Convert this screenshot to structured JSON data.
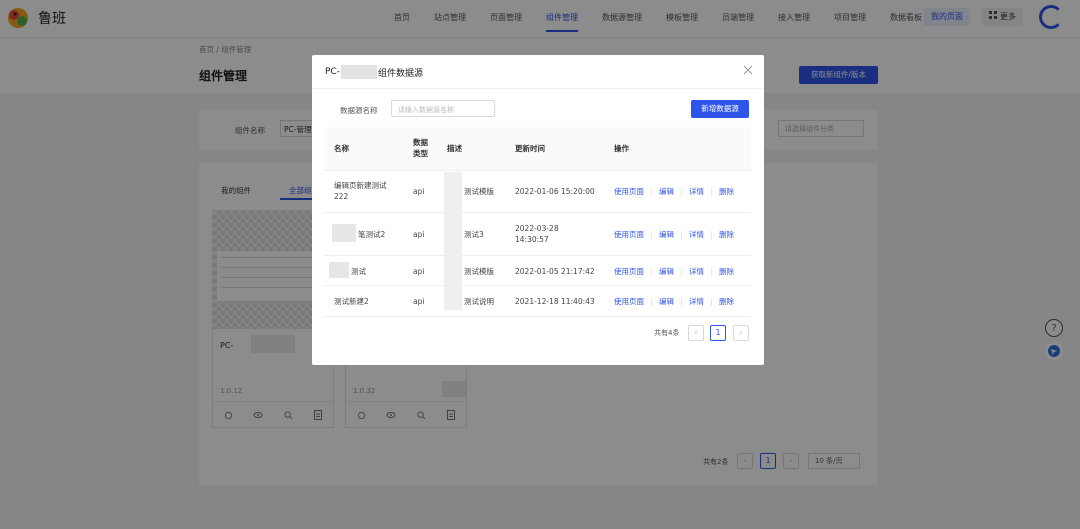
{
  "app": {
    "name": "鲁班"
  },
  "nav": {
    "items": [
      "首页",
      "站点管理",
      "页面管理",
      "组件管理",
      "数据源管理",
      "模板管理",
      "员端管理",
      "接入管理",
      "项目管理",
      "数据看板"
    ],
    "active_index": 3,
    "my_page": "我的页面",
    "more": "更多",
    "accent": "#2f54eb"
  },
  "breadcrumb": "首页 / 组件管理",
  "page_title": "组件管理",
  "get_button": "获取新组件/版本",
  "filter": {
    "name_label": "组件名称",
    "name_value": "PC-管理",
    "category_placeholder": "请选择组件分类"
  },
  "tabs": [
    "我的组件",
    "全部组件"
  ],
  "cards": [
    {
      "name": "PC-",
      "version": "1.0.12"
    },
    {
      "name": "",
      "version": "1.0.32"
    }
  ],
  "list_pager": {
    "total": "共有2条",
    "current": "1",
    "page_size": "10 条/页"
  },
  "modal": {
    "title_prefix": "PC-",
    "title_suffix": "组件数据源",
    "source_label": "数据源名称",
    "source_placeholder": "请输入数据源名称",
    "add_button": "新增数据源",
    "columns": {
      "name": "名称",
      "type": "数据\n类型",
      "desc": "描述",
      "updated": "更新时间",
      "ops": "操作"
    },
    "rows": [
      {
        "name": "编辑页新建测试\n222",
        "type": "api",
        "desc": "测试模版",
        "updated": "2022-01-06 15:20:00"
      },
      {
        "name": "笔测试2",
        "type": "api",
        "desc": "测试3",
        "updated": "2022-03-28\n14:30:57"
      },
      {
        "name": "测试",
        "type": "api",
        "desc": "测试模版",
        "updated": "2022-01-05 21:17:42"
      },
      {
        "name": "测试新建2",
        "type": "api",
        "desc": "测试说明",
        "updated": "2021-12-18 11:40:43"
      }
    ],
    "actions": [
      "使用页面",
      "编辑",
      "详情",
      "删除"
    ],
    "total": "共有4条",
    "current_page": "1"
  }
}
